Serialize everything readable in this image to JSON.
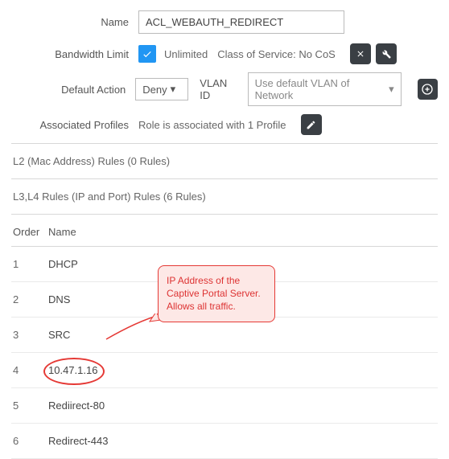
{
  "form": {
    "name_label": "Name",
    "name_value": "ACL_WEBAUTH_REDIRECT",
    "bandwidth_label": "Bandwidth Limit",
    "bandwidth_unlimited": "Unlimited",
    "cos_label": "Class of Service: No CoS",
    "default_action_label": "Default Action",
    "default_action_value": "Deny",
    "vlan_label": "VLAN ID",
    "vlan_placeholder": "Use default VLAN of Network",
    "assoc_label": "Associated Profiles",
    "assoc_text": "Role is associated with 1 Profile"
  },
  "sections": {
    "l2_header": "L2 (Mac Address) Rules (0 Rules)",
    "l3l4_header": "L3,L4 Rules (IP and Port) Rules (6 Rules)"
  },
  "columns": {
    "order": "Order",
    "name": "Name"
  },
  "rules": [
    {
      "order": "1",
      "name": "DHCP"
    },
    {
      "order": "2",
      "name": "DNS"
    },
    {
      "order": "3",
      "name": "SRC"
    },
    {
      "order": "4",
      "name": "10.47.1.16"
    },
    {
      "order": "5",
      "name": "Rediirect-80"
    },
    {
      "order": "6",
      "name": "Redirect-443"
    }
  ],
  "callout": {
    "text": "IP Address of the Captive Portal Server. Allows all traffic."
  }
}
